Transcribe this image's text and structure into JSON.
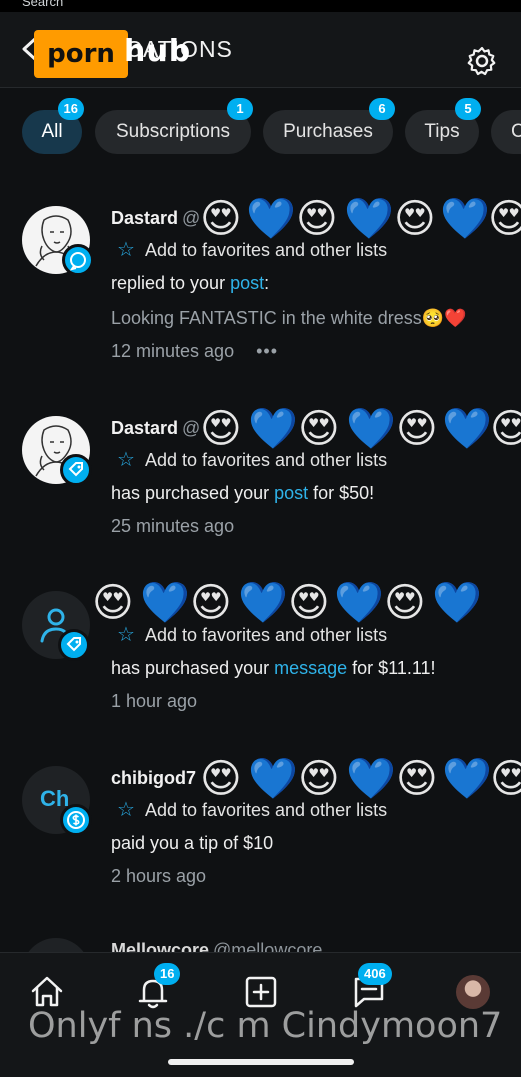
{
  "status": {
    "text": "Search"
  },
  "header": {
    "title": "NOTIFICATIONS",
    "logo_text": "porn",
    "watermark_text": "hub"
  },
  "filters": [
    {
      "label": "All",
      "badge": "16",
      "active": true
    },
    {
      "label": "Subscriptions",
      "badge": "1"
    },
    {
      "label": "Purchases",
      "badge": "6"
    },
    {
      "label": "Tips",
      "badge": "5"
    },
    {
      "label": "C",
      "badge": ""
    }
  ],
  "notifications": [
    {
      "name": "Dastard",
      "handle": "@",
      "fav_label": "Add to favorites and other lists",
      "text_before": "replied to your ",
      "link": "post",
      "text_after": ":",
      "comment": "Looking FANTASTIC in the white dress🥺❤️",
      "time": "12 minutes ago",
      "more": "•••"
    },
    {
      "name": "Dastard",
      "handle": "@",
      "fav_label": "Add to favorites and other lists",
      "text_before": "has purchased your ",
      "link": "post",
      "text_after": " for $50!",
      "time": "25 minutes ago"
    },
    {
      "name": "",
      "handle": "",
      "fav_label": "Add to favorites and other lists",
      "text_before": "has purchased your ",
      "link": "message",
      "text_after": " for $11.11!",
      "time": "1 hour ago"
    },
    {
      "name": "chibigod7",
      "handle": "",
      "avatar_initials": "Ch",
      "fav_label": "Add to favorites and other lists",
      "text_before": "paid you a tip of $10",
      "link": "",
      "text_after": "",
      "time": "2 hours ago"
    }
  ],
  "next_peek": {
    "name": "Mellowcore",
    "handle": "@mellowcore"
  },
  "emoji_censor": {
    "heart_eyes": "😍",
    "blue_heart": "💙"
  },
  "bottom_nav": {
    "notifications_badge": "16",
    "messages_badge": "406"
  },
  "watermark_bottom": "Onlyf ns ./c m Cindymoon7",
  "colors": {
    "accent": "#00aff0",
    "link": "#2fb3e9",
    "active_chip": "#17384c"
  }
}
